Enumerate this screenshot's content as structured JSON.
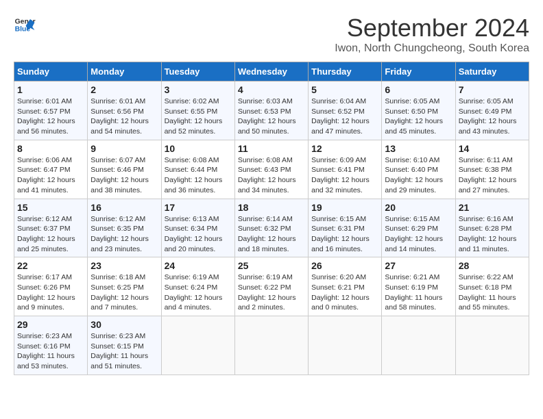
{
  "header": {
    "logo_general": "General",
    "logo_blue": "Blue",
    "month": "September 2024",
    "location": "Iwon, North Chungcheong, South Korea"
  },
  "weekdays": [
    "Sunday",
    "Monday",
    "Tuesday",
    "Wednesday",
    "Thursday",
    "Friday",
    "Saturday"
  ],
  "weeks": [
    [
      {
        "day": "1",
        "sunrise": "6:01 AM",
        "sunset": "6:57 PM",
        "daylight": "12 hours and 56 minutes."
      },
      {
        "day": "2",
        "sunrise": "6:01 AM",
        "sunset": "6:56 PM",
        "daylight": "12 hours and 54 minutes."
      },
      {
        "day": "3",
        "sunrise": "6:02 AM",
        "sunset": "6:55 PM",
        "daylight": "12 hours and 52 minutes."
      },
      {
        "day": "4",
        "sunrise": "6:03 AM",
        "sunset": "6:53 PM",
        "daylight": "12 hours and 50 minutes."
      },
      {
        "day": "5",
        "sunrise": "6:04 AM",
        "sunset": "6:52 PM",
        "daylight": "12 hours and 47 minutes."
      },
      {
        "day": "6",
        "sunrise": "6:05 AM",
        "sunset": "6:50 PM",
        "daylight": "12 hours and 45 minutes."
      },
      {
        "day": "7",
        "sunrise": "6:05 AM",
        "sunset": "6:49 PM",
        "daylight": "12 hours and 43 minutes."
      }
    ],
    [
      {
        "day": "8",
        "sunrise": "6:06 AM",
        "sunset": "6:47 PM",
        "daylight": "12 hours and 41 minutes."
      },
      {
        "day": "9",
        "sunrise": "6:07 AM",
        "sunset": "6:46 PM",
        "daylight": "12 hours and 38 minutes."
      },
      {
        "day": "10",
        "sunrise": "6:08 AM",
        "sunset": "6:44 PM",
        "daylight": "12 hours and 36 minutes."
      },
      {
        "day": "11",
        "sunrise": "6:08 AM",
        "sunset": "6:43 PM",
        "daylight": "12 hours and 34 minutes."
      },
      {
        "day": "12",
        "sunrise": "6:09 AM",
        "sunset": "6:41 PM",
        "daylight": "12 hours and 32 minutes."
      },
      {
        "day": "13",
        "sunrise": "6:10 AM",
        "sunset": "6:40 PM",
        "daylight": "12 hours and 29 minutes."
      },
      {
        "day": "14",
        "sunrise": "6:11 AM",
        "sunset": "6:38 PM",
        "daylight": "12 hours and 27 minutes."
      }
    ],
    [
      {
        "day": "15",
        "sunrise": "6:12 AM",
        "sunset": "6:37 PM",
        "daylight": "12 hours and 25 minutes."
      },
      {
        "day": "16",
        "sunrise": "6:12 AM",
        "sunset": "6:35 PM",
        "daylight": "12 hours and 23 minutes."
      },
      {
        "day": "17",
        "sunrise": "6:13 AM",
        "sunset": "6:34 PM",
        "daylight": "12 hours and 20 minutes."
      },
      {
        "day": "18",
        "sunrise": "6:14 AM",
        "sunset": "6:32 PM",
        "daylight": "12 hours and 18 minutes."
      },
      {
        "day": "19",
        "sunrise": "6:15 AM",
        "sunset": "6:31 PM",
        "daylight": "12 hours and 16 minutes."
      },
      {
        "day": "20",
        "sunrise": "6:15 AM",
        "sunset": "6:29 PM",
        "daylight": "12 hours and 14 minutes."
      },
      {
        "day": "21",
        "sunrise": "6:16 AM",
        "sunset": "6:28 PM",
        "daylight": "12 hours and 11 minutes."
      }
    ],
    [
      {
        "day": "22",
        "sunrise": "6:17 AM",
        "sunset": "6:26 PM",
        "daylight": "12 hours and 9 minutes."
      },
      {
        "day": "23",
        "sunrise": "6:18 AM",
        "sunset": "6:25 PM",
        "daylight": "12 hours and 7 minutes."
      },
      {
        "day": "24",
        "sunrise": "6:19 AM",
        "sunset": "6:24 PM",
        "daylight": "12 hours and 4 minutes."
      },
      {
        "day": "25",
        "sunrise": "6:19 AM",
        "sunset": "6:22 PM",
        "daylight": "12 hours and 2 minutes."
      },
      {
        "day": "26",
        "sunrise": "6:20 AM",
        "sunset": "6:21 PM",
        "daylight": "12 hours and 0 minutes."
      },
      {
        "day": "27",
        "sunrise": "6:21 AM",
        "sunset": "6:19 PM",
        "daylight": "11 hours and 58 minutes."
      },
      {
        "day": "28",
        "sunrise": "6:22 AM",
        "sunset": "6:18 PM",
        "daylight": "11 hours and 55 minutes."
      }
    ],
    [
      {
        "day": "29",
        "sunrise": "6:23 AM",
        "sunset": "6:16 PM",
        "daylight": "11 hours and 53 minutes."
      },
      {
        "day": "30",
        "sunrise": "6:23 AM",
        "sunset": "6:15 PM",
        "daylight": "11 hours and 51 minutes."
      },
      null,
      null,
      null,
      null,
      null
    ]
  ]
}
